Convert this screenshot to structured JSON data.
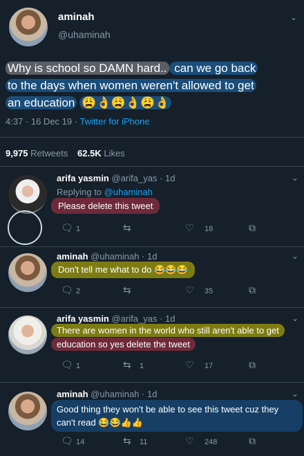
{
  "main_tweet": {
    "display_name": "aminah",
    "handle": "@uhaminah",
    "text_line1": "Why is school so DAMN hard..",
    "text_line1b": " can we go back",
    "text_line2": "to the days when women weren't allowed to get",
    "text_line3": "an education",
    "text_emojis": "😩👌😩👌😩👌",
    "timestamp": "4:37 · 16 Dec 19 · ",
    "client": "Twitter for iPhone",
    "retweets_count": "9,975",
    "retweets_label": "Retweets",
    "likes_count": "62.5K",
    "likes_label": "Likes"
  },
  "replies": [
    {
      "display_name": "arifa yasmin",
      "meta": "@arifa_yas · 1d",
      "replying_to": "Replying to ",
      "replying_handle": "@uhaminah",
      "text": "Please delete this tweet",
      "replies": "1",
      "retweets": "",
      "likes": "18"
    },
    {
      "display_name": "aminah",
      "meta": "@uhaminah · 1d",
      "text": "Don't tell me what to do",
      "text_emojis": "😂😂😂",
      "replies": "2",
      "retweets": "",
      "likes": "35"
    },
    {
      "display_name": "arifa yasmin",
      "meta": "@arifa_yas · 1d",
      "text_line1": "There are women in the world who still aren't able to get",
      "text_line2": "education so yes delete the tweet",
      "replies": "1",
      "retweets": "1",
      "likes": "17"
    },
    {
      "display_name": "aminah",
      "meta": "@uhaminah · 1d",
      "text_line1": "Good thing they won't be able to see this tweet cuz they",
      "text_line2": "can't read",
      "text_emojis": "😂😂👍👍",
      "replies": "14",
      "retweets": "11",
      "likes": "248"
    }
  ],
  "icons": {
    "reply": "speech-bubble-icon",
    "retweet": "retweet-icon",
    "like": "heart-icon",
    "share": "share-icon",
    "more": "chevron-down-icon"
  },
  "colors": {
    "background": "#15202b",
    "muted": "#8899a6",
    "link": "#1da1f2"
  }
}
